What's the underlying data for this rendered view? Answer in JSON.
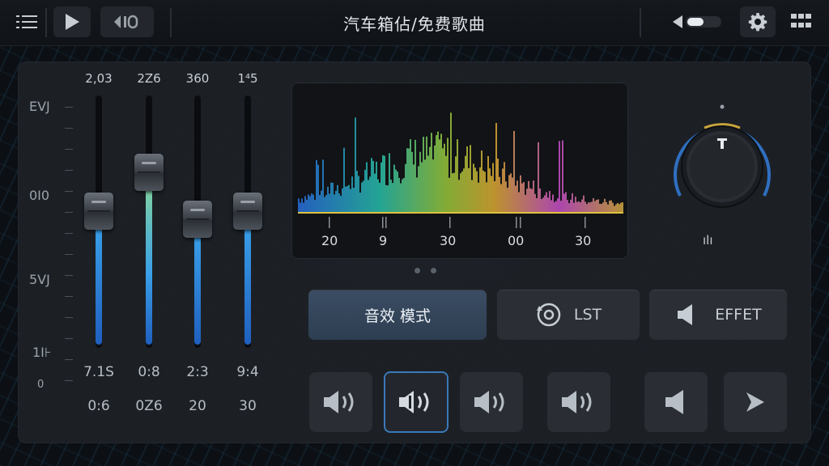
{
  "topbar": {
    "title": "汽车箱佔/免费歌曲",
    "icons": [
      "menu-icon",
      "play-icon",
      "sound-icon",
      "volume-icon",
      "gear-icon",
      "grid-icon"
    ]
  },
  "eq": {
    "scale": [
      "EVJ",
      "0I0",
      "5VJ",
      "1I⊦",
      "0"
    ],
    "bands": [
      {
        "top": "2,03",
        "value1": "7.1S",
        "value2": "0:6",
        "level": 0.52,
        "color": "#3aa0e8"
      },
      {
        "top": "2Z6",
        "value1": "0:8",
        "value2": "0Z6",
        "level": 0.7,
        "color": "#7fd3a0"
      },
      {
        "top": "360",
        "value1": "2:3",
        "value2": "20",
        "level": 0.48,
        "color": "#3aa0e8"
      },
      {
        "top": "1⁴5",
        "value1": "9:4",
        "value2": "30",
        "level": 0.52,
        "color": "#3aa0e8"
      }
    ]
  },
  "spectrum": {
    "labels": [
      "20",
      "9",
      "30",
      "00",
      "30"
    ]
  },
  "knob": {
    "label": "ılı"
  },
  "buttons": {
    "mode": "音效 模式",
    "lst": "LST",
    "effet": "EFFET"
  },
  "colors": {
    "accent": "#3b78b8",
    "fill": "#3aa0e8",
    "green": "#7fd3a0"
  }
}
